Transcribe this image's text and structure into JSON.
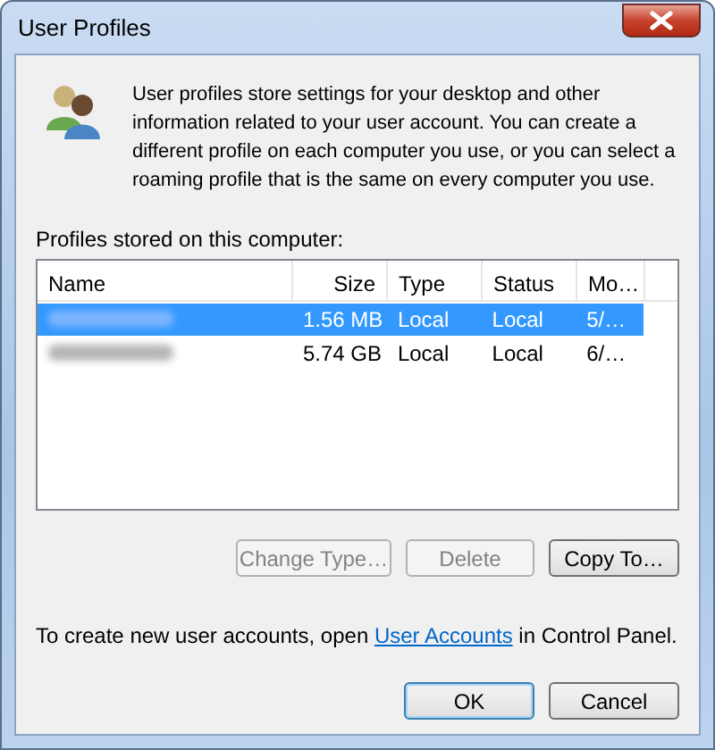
{
  "window": {
    "title": "User Profiles"
  },
  "description": "User profiles store settings for your desktop and other information related to your user account. You can create a different profile on each computer you use, or you can select a roaming profile that is the same on every computer you use.",
  "list_label": "Profiles stored on this computer:",
  "table": {
    "columns": [
      "Name",
      "Size",
      "Type",
      "Status",
      "Mo…"
    ],
    "rows": [
      {
        "selected": true,
        "cells": [
          "",
          "1.56 MB",
          "Local",
          "Local",
          "5/…"
        ]
      },
      {
        "selected": false,
        "cells": [
          "",
          "5.74 GB",
          "Local",
          "Local",
          "6/…"
        ]
      }
    ]
  },
  "actions": [
    {
      "label": "Change Type…",
      "disabled": true
    },
    {
      "label": "Delete",
      "disabled": true
    },
    {
      "label": "Copy To…",
      "disabled": false
    }
  ],
  "footer": {
    "before": "To create new user accounts, open ",
    "link": "User Accounts",
    "after": " in Control Panel."
  },
  "buttons": [
    {
      "label": "OK",
      "default": true
    },
    {
      "label": "Cancel",
      "default": false
    }
  ]
}
